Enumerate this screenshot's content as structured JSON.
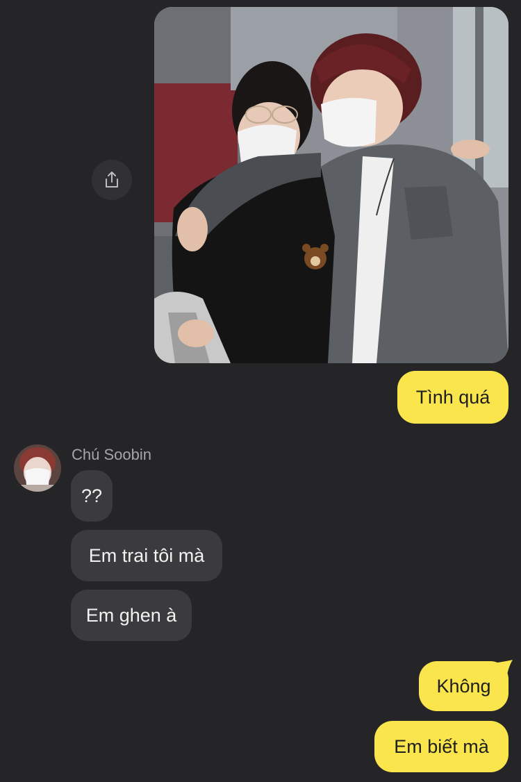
{
  "chat": {
    "photo": {
      "description_icon": "shared-photo"
    },
    "share_icon": "share-icon",
    "messages": [
      {
        "id": "m1",
        "from": "me",
        "text": "Tình quá"
      },
      {
        "id": "m2",
        "from": "them",
        "text": "??"
      },
      {
        "id": "m3",
        "from": "them",
        "text": "Em trai tôi mà"
      },
      {
        "id": "m4",
        "from": "them",
        "text": "Em ghen à"
      },
      {
        "id": "m5",
        "from": "me",
        "text": "Không"
      },
      {
        "id": "m6",
        "from": "me",
        "text": "Em biết mà"
      }
    ],
    "contact": {
      "name": "Chú Soobin"
    },
    "colors": {
      "background": "#252527",
      "my_bubble": "#fae64c",
      "their_bubble": "#3b3b3e"
    }
  }
}
